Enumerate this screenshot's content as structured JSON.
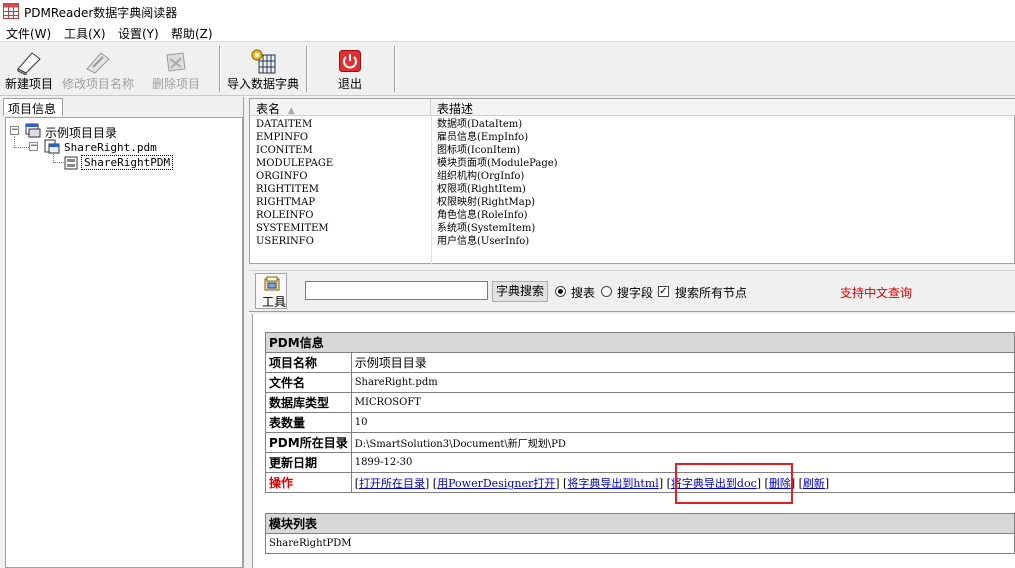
{
  "window": {
    "title": "PDMReader数据字典阅读器"
  },
  "menu": [
    "文件(W)",
    "工具(X)",
    "设置(Y)",
    "帮助(Z)"
  ],
  "toolbar": {
    "new_project": "新建项目",
    "rename_project": "修改项目名称",
    "delete_project": "删除项目",
    "import_dictionary": "导入数据字典",
    "exit": "退出"
  },
  "left_panel": {
    "tab_label": "项目信息",
    "tree": {
      "root": "示例项目目录",
      "file": "ShareRight.pdm",
      "module": "ShareRightPDM"
    }
  },
  "table_list": {
    "columns": [
      "表名",
      "表描述"
    ],
    "rows": [
      [
        "DATAITEM",
        "数据项(DataItem)"
      ],
      [
        "EMPINFO",
        "雇员信息(EmpInfo)"
      ],
      [
        "ICONITEM",
        "图标项(IconItem)"
      ],
      [
        "MODULEPAGE",
        "模块页面项(ModulePage)"
      ],
      [
        "ORGINFO",
        "组织机构(OrgInfo)"
      ],
      [
        "RIGHTITEM",
        "权限项(RightItem)"
      ],
      [
        "RIGHTMAP",
        "权限映射(RightMap)"
      ],
      [
        "ROLEINFO",
        "角色信息(RoleInfo)"
      ],
      [
        "SYSTEMITEM",
        "系统项(SystemItem)"
      ],
      [
        "USERINFO",
        "用户信息(UserInfo)"
      ]
    ]
  },
  "search": {
    "tools_label": "工具",
    "input_value": "",
    "button_label": "字典搜索",
    "radio_table": "搜表",
    "radio_field": "搜字段",
    "checkbox_all_nodes": "搜索所有节点",
    "hint": "支持中文查询"
  },
  "pdm_info": {
    "section_title": "PDM信息",
    "rows": [
      {
        "label": "项目名称",
        "value": "示例项目目录"
      },
      {
        "label": "文件名",
        "value": "ShareRight.pdm"
      },
      {
        "label": "数据库类型",
        "value": "MICROSOFT"
      },
      {
        "label": "表数量",
        "value": "10"
      },
      {
        "label": "PDM所在目录",
        "value": "D:\\SmartSolution3\\Document\\新厂规划\\PD"
      },
      {
        "label": "更新日期",
        "value": "1899-12-30"
      }
    ],
    "operations_label": "操作",
    "operations": {
      "open_dir": "打开所在目录",
      "open_pd": "用PowerDesigner打开",
      "export_html": "将字典导出到html",
      "export_doc": "将字典导出到doc",
      "delete": "删除",
      "refresh": "刷新"
    }
  },
  "module_list": {
    "section_title": "模块列表",
    "items": [
      "ShareRightPDM"
    ]
  },
  "colors": {
    "hint_red": "#e00000",
    "link_blue": "#0000cc",
    "highlight": "#e02020"
  }
}
